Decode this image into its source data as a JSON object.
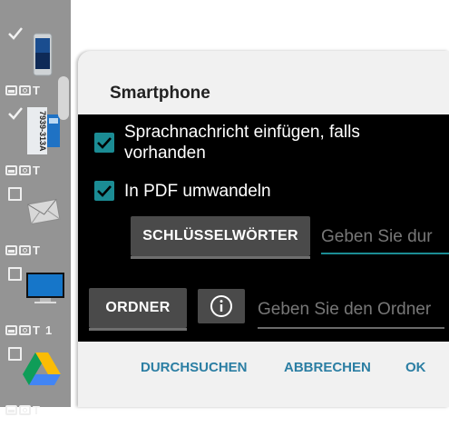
{
  "strip": {
    "items": [
      {
        "checked": true,
        "thumb": "smartphone-thumbnail",
        "type_label": "T"
      },
      {
        "checked": true,
        "thumb": "sd-card-thumbnail",
        "type_label": "T",
        "card_text": "7939-313A"
      },
      {
        "checked": false,
        "thumb": "envelope-thumbnail",
        "type_label": "T"
      },
      {
        "checked": false,
        "thumb": "monitor-thumbnail",
        "type_label": "T",
        "count": "1"
      },
      {
        "checked": false,
        "thumb": "google-drive-thumbnail",
        "type_label": "T"
      }
    ]
  },
  "dialog": {
    "title": "Smartphone",
    "options": [
      {
        "label": "Sprachnachricht einfügen, falls",
        "label_line2": "vorhanden",
        "checked": true
      },
      {
        "label": "In PDF umwandeln",
        "checked": true
      }
    ],
    "keywords_button": "SCHLÜSSELWÖRTER",
    "keywords_placeholder": "Geben Sie dur",
    "folder_button": "ORDNER",
    "folder_placeholder": "Geben Sie den Ordner",
    "footer": {
      "browse": "DURCHSUCHEN",
      "cancel": "ABBRECHEN",
      "ok": "OK"
    }
  },
  "colors": {
    "accent_teal": "#1b8c94",
    "button_gray": "#4a4a4a",
    "footer_text": "#2b7ea3",
    "strip_bg": "#949494"
  }
}
